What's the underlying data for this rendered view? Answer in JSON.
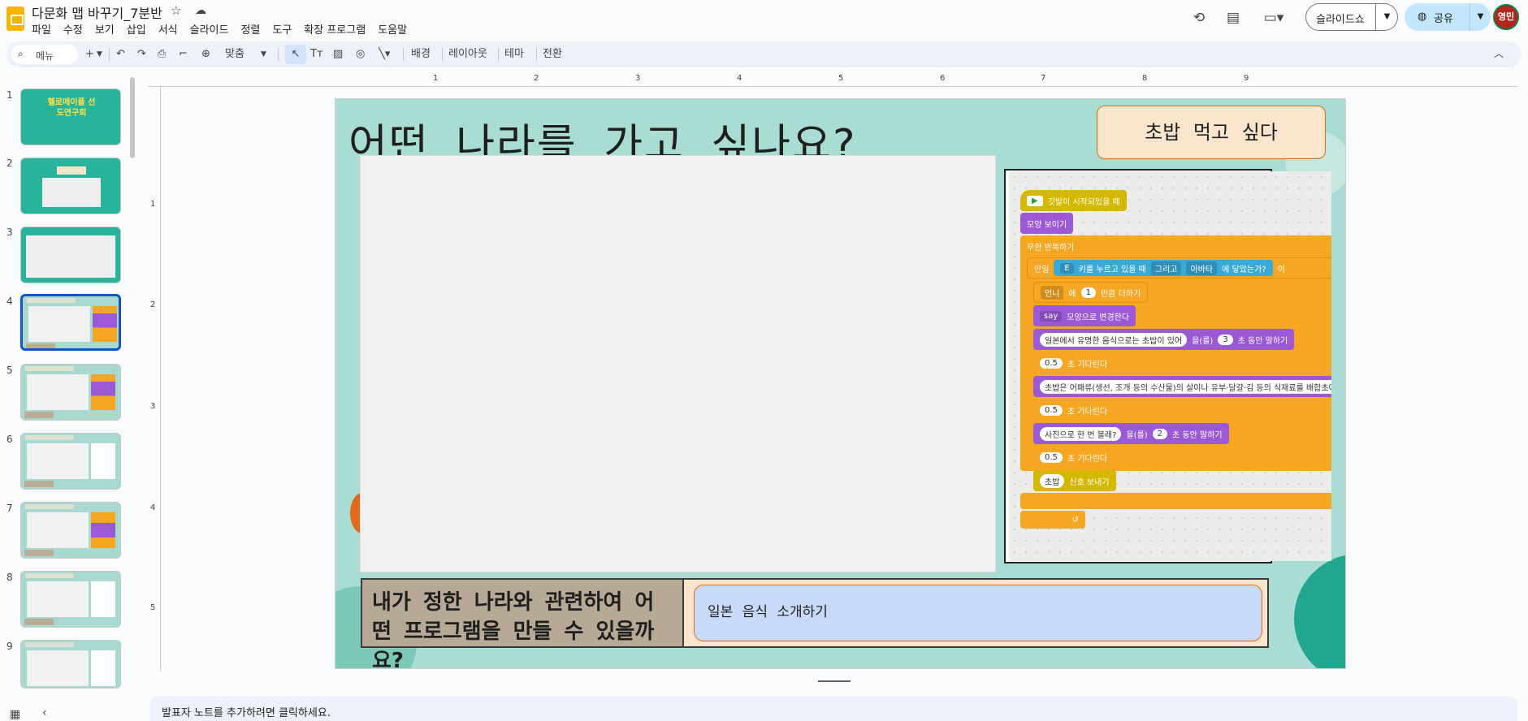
{
  "app": {
    "title": "다문화 맵 바꾸기_7분반",
    "menus": [
      "파일",
      "수정",
      "보기",
      "삽입",
      "서식",
      "슬라이드",
      "정렬",
      "도구",
      "확장 프로그램",
      "도움말"
    ],
    "slideshow_label": "슬라이드쇼",
    "share_label": "공유",
    "avatar_label": "영민"
  },
  "toolbar": {
    "search_label": "메뉴",
    "zoom_label": "맞춤",
    "background_label": "배경",
    "layout_label": "레이아웃",
    "theme_label": "테마",
    "transition_label": "전환"
  },
  "rulers": {
    "top": [
      "1",
      "2",
      "3",
      "4",
      "5",
      "6",
      "7",
      "8",
      "9"
    ],
    "left": [
      "1",
      "2",
      "3",
      "4",
      "5"
    ]
  },
  "filmstrip": {
    "slides": [
      "1",
      "2",
      "3",
      "4",
      "5",
      "6",
      "7",
      "8",
      "9"
    ],
    "active": "4",
    "slide1_text": "헬로메이플 선도연구회"
  },
  "slide": {
    "title": "어떤 나라를 가고 싶나요?",
    "callout": "초밥 먹고 싶다",
    "question": "내가 정한 나라와 관련하여 어떤 프로그램을 만들 수 있을까요?",
    "answer": "일본 음식 소개하기"
  },
  "code": {
    "when_start": "깃발이 시작되었을 때",
    "show": "모양 보이기",
    "forever": "무한 반복하기",
    "if_label": "만일",
    "key": "E",
    "key_pressed": "키를 누르고 있을 때",
    "and_label": "그리고",
    "avatar": "아바타",
    "touching": "에 닿았는가?",
    "if_tail": "이",
    "var_dd": "언니",
    "var_of": "에",
    "var_num": "1",
    "var_add": "만큼 더하기",
    "say_dd": "say",
    "say_change": "모양으로 변경한다",
    "say1_text": "일본에서 유명한 음식으로는 초밥이 있어",
    "say1_eul": "을(를)",
    "say1_sec": "3",
    "say1_tail": "초 동안 말하기",
    "wait_val": "0.5",
    "wait_tail": "초 기다린다",
    "say2_text": "초밥은 어패류(생선, 조개 등의 수산물)의 살이나 유부·달걀·김 등의 식재료를 배합초에 절인 밥",
    "say3_text": "사진으로 한 번 볼래?",
    "say3_eul": "을(를)",
    "say3_sec": "2",
    "say3_tail": "초 동안 말하기",
    "signal": "초밥",
    "signal_tail": "신호 보내기"
  },
  "notes": {
    "placeholder": "발표자 노트를 추가하려면 클릭하세요."
  },
  "colors": {
    "slide_bg": "#a9dcd2",
    "callout_bg": "#fce5cd",
    "answer_bg": "#c9daf8",
    "question_bg": "#b6a995",
    "active_thumb": "#0b57d0",
    "share_bg": "#c2e7ff"
  }
}
